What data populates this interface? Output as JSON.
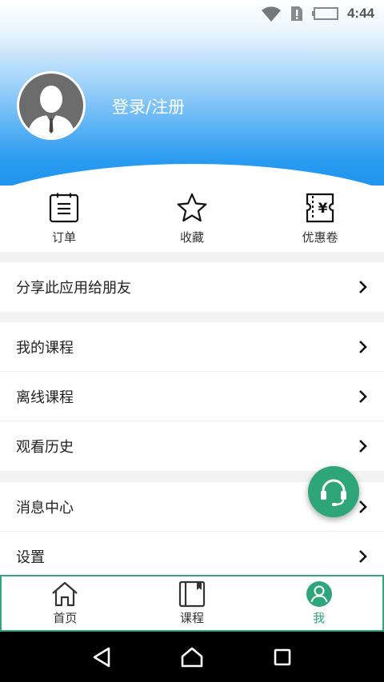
{
  "status_bar": {
    "time": "4:44"
  },
  "profile": {
    "login_label": "登录/注册"
  },
  "quick_actions": [
    {
      "label": "订单",
      "icon": "order-icon"
    },
    {
      "label": "收藏",
      "icon": "star-icon"
    },
    {
      "label": "优惠卷",
      "icon": "coupon-icon"
    }
  ],
  "menu": {
    "share": "分享此应用给朋友",
    "my_courses": "我的课程",
    "offline_courses": "离线课程",
    "history": "观看历史",
    "messages": "消息中心",
    "settings": "设置"
  },
  "tabs": [
    {
      "label": "首页",
      "icon": "home-icon"
    },
    {
      "label": "课程",
      "icon": "book-icon"
    },
    {
      "label": "我",
      "icon": "profile-icon"
    }
  ],
  "colors": {
    "accent": "#2fa57a",
    "header_blue": "#1f94ee"
  }
}
